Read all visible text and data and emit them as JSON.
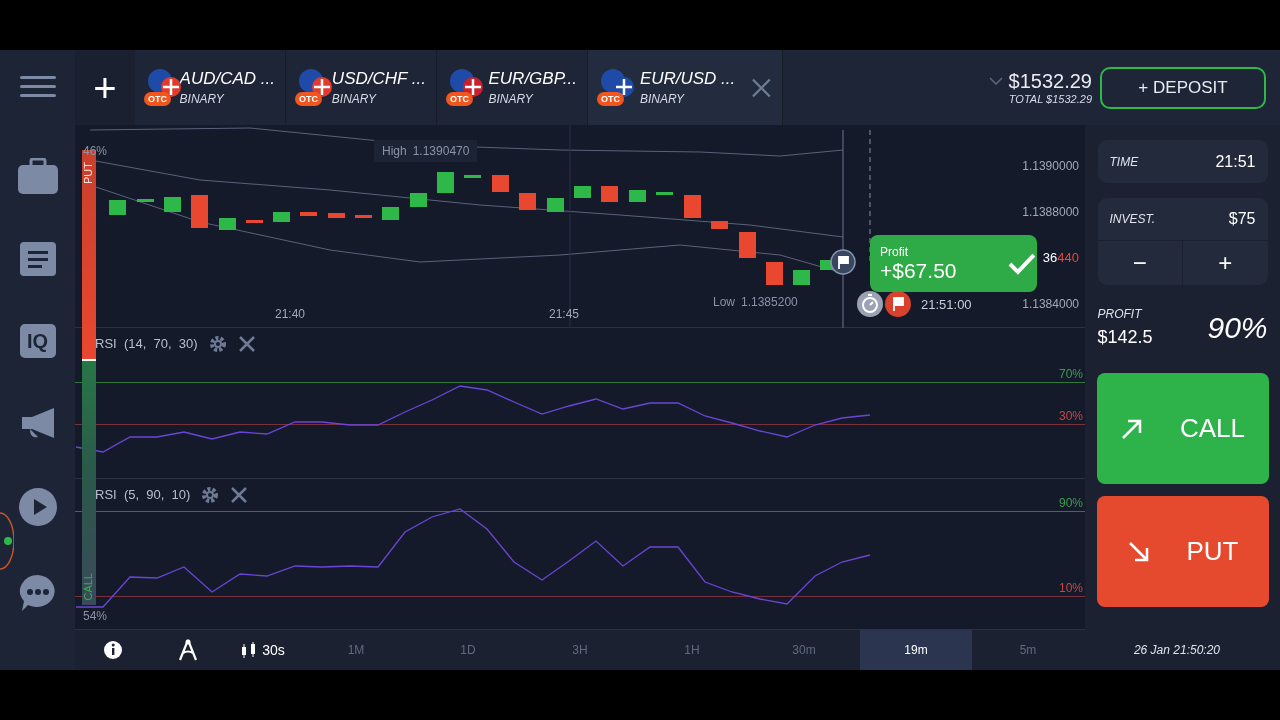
{
  "sidebar": {
    "logo_text": "IQ"
  },
  "top_bar": {
    "add_symbol": "+",
    "tabs": [
      {
        "pair": "AUD/CAD ...",
        "badge": "OTC",
        "type": "BINARY",
        "selected": false
      },
      {
        "pair": "USD/CHF ...",
        "badge": "OTC",
        "type": "BINARY",
        "selected": false
      },
      {
        "pair": "EUR/GBP...",
        "badge": "OTC",
        "type": "BINARY",
        "selected": false
      },
      {
        "pair": "EUR/USD ...",
        "badge": "OTC",
        "type": "BINARY",
        "selected": true
      }
    ],
    "balance": "$1532.29",
    "total": "TOTAL $1532.29",
    "deposit_button": "+ DEPOSIT"
  },
  "chart": {
    "sentiment": {
      "put_label": "PUT",
      "put_percent": "46%",
      "call_label": "CALL",
      "call_percent": "54%",
      "level": 0.46
    },
    "high": {
      "label": "High",
      "value": "1.1390470"
    },
    "low": {
      "label": "Low",
      "value": "1.1385200"
    },
    "price_ticks": [
      "1.1390000",
      "1.1388000",
      "1.1384000"
    ],
    "current_price": {
      "hidden_part": "36",
      "changing_part": "440"
    },
    "time_ticks": [
      "21:40",
      "21:45"
    ],
    "expiry_time": "21:51:00",
    "profit_popup": {
      "label": "Profit",
      "amount": "+$67.50"
    }
  },
  "indicators": [
    {
      "name": "RSI  (14,  70,  30)",
      "upper": "70%",
      "lower": "30%"
    },
    {
      "name": "RSI  (5,  90,  10)",
      "upper": "90%",
      "lower": "10%"
    }
  ],
  "right_panel": {
    "time": {
      "label": "TIME",
      "value": "21:51"
    },
    "invest": {
      "label": "INVEST.",
      "value": "$75",
      "minus": "−",
      "plus": "+"
    },
    "profit": {
      "label": "PROFIT",
      "value": "$142.5",
      "percent": "90%"
    },
    "call_button": "CALL",
    "put_button": "PUT"
  },
  "bottom_bar": {
    "timeframe": "30s",
    "periods": [
      {
        "label": "1M",
        "selected": false
      },
      {
        "label": "1D",
        "selected": false
      },
      {
        "label": "3H",
        "selected": false
      },
      {
        "label": "1H",
        "selected": false
      },
      {
        "label": "30m",
        "selected": false
      },
      {
        "label": "19m",
        "selected": true
      },
      {
        "label": "5m",
        "selected": false
      }
    ],
    "date": "26 Jan 21:50:20"
  }
}
